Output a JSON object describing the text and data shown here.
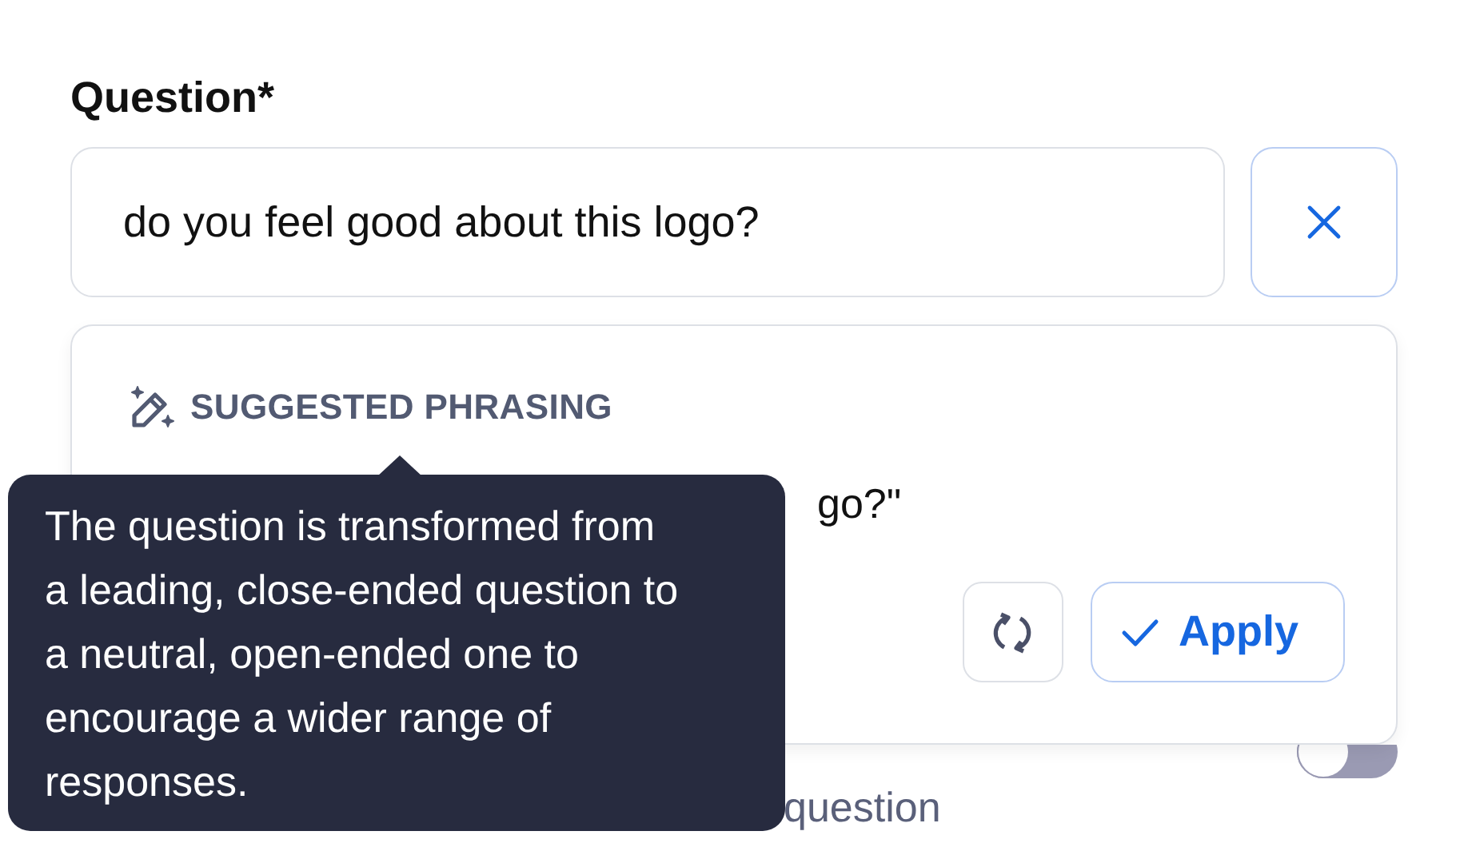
{
  "question": {
    "label": "Question*",
    "value": "do you feel good about this logo?"
  },
  "suggestion": {
    "heading": "SUGGESTED PHRASING",
    "text": "go?\""
  },
  "tooltip": {
    "text": "The question is transformed from a leading, close-ended question to a neutral, open-ended one to encourage a wider range of responses."
  },
  "apply_button": {
    "label": "Apply"
  },
  "option": {
    "label": "question",
    "on": false
  }
}
